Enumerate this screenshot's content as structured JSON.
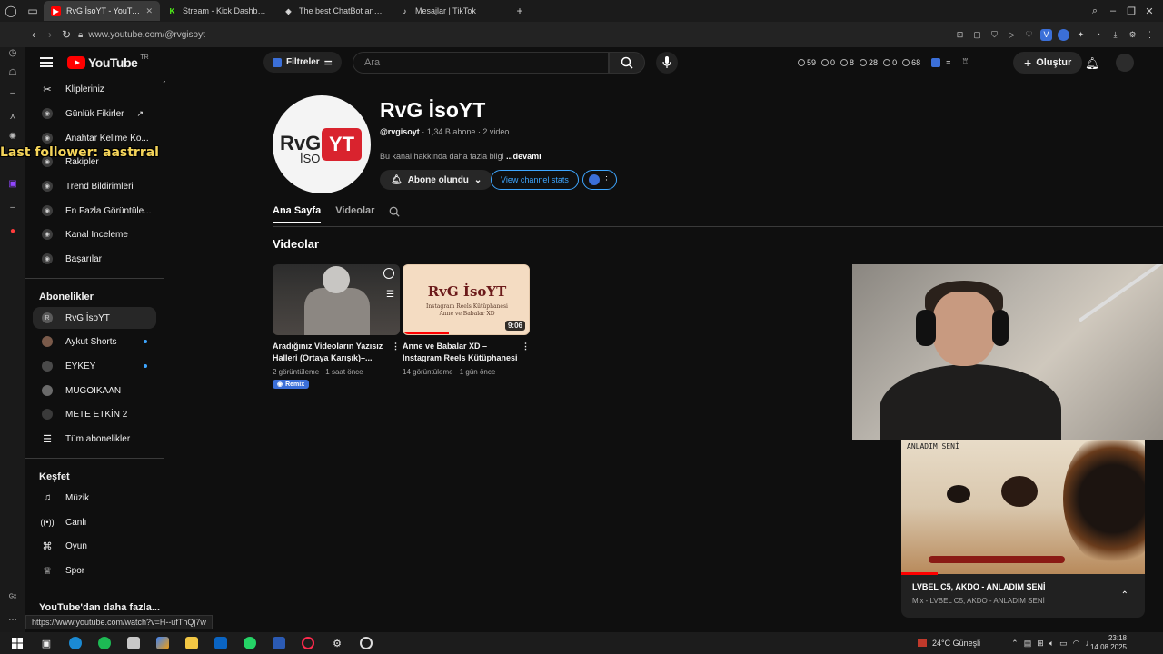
{
  "browser": {
    "tabs": [
      {
        "label": "RvG İsoYT - YouTube",
        "active": true,
        "favicon": "youtube-icon",
        "color": "#ff0000"
      },
      {
        "label": "Stream - Kick Dashboard",
        "active": false,
        "favicon": "kick-icon",
        "color": "#53fc18"
      },
      {
        "label": "The best ChatBot and Wi",
        "active": false,
        "favicon": "chatbot-icon",
        "color": "#cccccc"
      },
      {
        "label": "Mesajlar | TikTok",
        "active": false,
        "favicon": "tiktok-icon",
        "color": "#ffffff"
      }
    ],
    "new_tab": "+",
    "url": "www.youtube.com/@rvgisoyt"
  },
  "overlay": {
    "last_follower": "Last follower: aastrral"
  },
  "youtube": {
    "logo_text": "YouTube",
    "logo_region": "TR",
    "filter_label": "Filtreler",
    "search_placeholder": "Ara",
    "header_stats": [
      "59",
      "0",
      "8",
      "28",
      "0",
      "68"
    ],
    "create_label": "Oluştur"
  },
  "sidebar": {
    "top_items": [
      {
        "label": "Klipleriniz"
      },
      {
        "label": "Günlük Fikirler"
      },
      {
        "label": "Anahtar Kelime Ko..."
      },
      {
        "label": "Rakipler"
      },
      {
        "label": "Trend Bildirimleri"
      },
      {
        "label": "En Fazla Görüntüle..."
      },
      {
        "label": "Kanal Inceleme"
      },
      {
        "label": "Başarılar"
      }
    ],
    "subscriptions_heading": "Abonelikler",
    "subscriptions": [
      {
        "label": "RvG İsoYT",
        "active": true,
        "new": false
      },
      {
        "label": "Aykut Shorts",
        "active": false,
        "new": true
      },
      {
        "label": "EYKEY",
        "active": false,
        "new": true
      },
      {
        "label": "MUGOIKAAN",
        "active": false,
        "new": false
      },
      {
        "label": "METE ETKİN 2",
        "active": false,
        "new": false
      },
      {
        "label": "Tüm abonelikler",
        "active": false,
        "new": false
      }
    ],
    "explore_heading": "Keşfet",
    "explore": [
      {
        "label": "Müzik",
        "icon": "music-icon"
      },
      {
        "label": "Canlı",
        "icon": "live-icon"
      },
      {
        "label": "Oyun",
        "icon": "gaming-icon"
      },
      {
        "label": "Spor",
        "icon": "trophy-icon"
      }
    ],
    "more_heading": "YouTube'dan daha fazla..."
  },
  "channel": {
    "name": "RvG İsoYT",
    "avatar_text_1": "RvG",
    "avatar_text_2": "İSO",
    "avatar_badge": "YT",
    "handle": "@rvgisoyt",
    "subs": "1,34 B abone",
    "videos": "2 video",
    "description": "Bu kanal hakkında daha fazla bilgi",
    "more": "...devamı",
    "subscribe_label": "Abone olundu",
    "stats_label": "View channel stats",
    "tabs": [
      "Ana Sayfa",
      "Videolar"
    ],
    "section_title": "Videolar"
  },
  "videos": [
    {
      "title": "Aradığınız Videoların Yazısız Halleri (Ortaya Karışık)–...",
      "views": "2 görüntüleme",
      "age": "1 saat önce",
      "badge": "Remix",
      "duration": ""
    },
    {
      "title": "Anne ve Babalar XD – Instagram Reels Kütüphanesi",
      "views": "14 görüntüleme",
      "age": "1 gün önce",
      "duration": "9:06",
      "thumb_title": "RvG İsoYT",
      "thumb_sub1": "Instagram Reels Kütüphanesi",
      "thumb_sub2": "Anne ve Babalar XD",
      "watched_fraction": 0.36
    }
  ],
  "mini_player": {
    "title": "LVBEL C5, AKDO - ANLADIM SENİ",
    "subtitle": "Mix - LVBEL C5, AKDO - ANLADIM SENİ",
    "watermark": "ANLADIM SENİ"
  },
  "status_url": "https://www.youtube.com/watch?v=H--ufThQj7w",
  "taskbar": {
    "weather": "24°C Güneşli",
    "time": "23:18",
    "date": "14.08.2025"
  }
}
